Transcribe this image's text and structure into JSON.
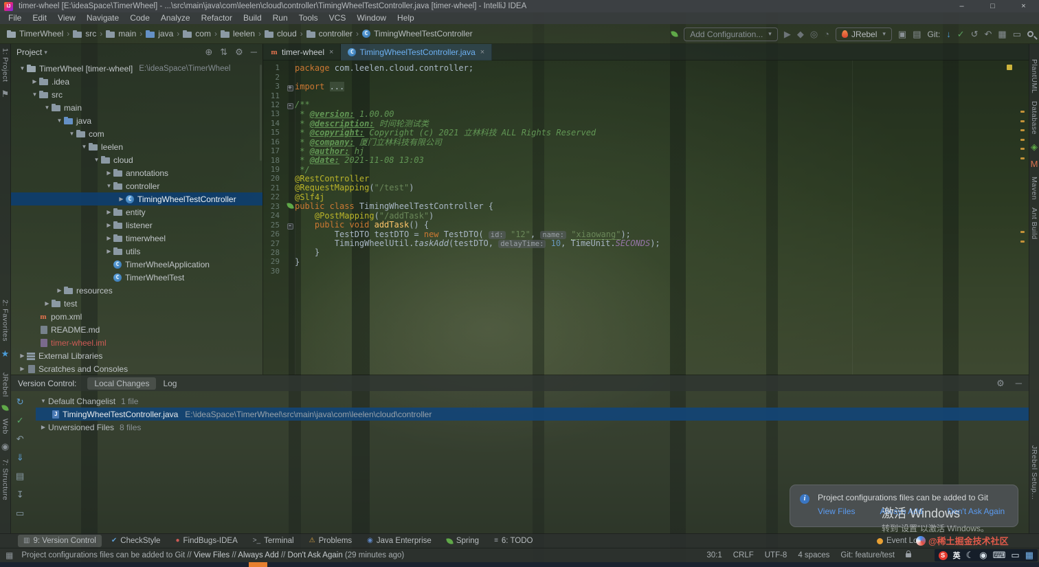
{
  "titlebar": {
    "title": "timer-wheel [E:\\ideaSpace\\TimerWheel] - ...\\src\\main\\java\\com\\leelen\\cloud\\controller\\TimingWheelTestController.java [timer-wheel] - IntelliJ IDEA",
    "controls": {
      "minimize": "–",
      "maximize": "□",
      "close": "×"
    }
  },
  "menubar": {
    "items": [
      "File",
      "Edit",
      "View",
      "Navigate",
      "Code",
      "Analyze",
      "Refactor",
      "Build",
      "Run",
      "Tools",
      "VCS",
      "Window",
      "Help"
    ]
  },
  "toolbar": {
    "breadcrumbs": [
      {
        "label": "TimerWheel",
        "icon": "project"
      },
      {
        "label": "src",
        "icon": "folder"
      },
      {
        "label": "main",
        "icon": "folder"
      },
      {
        "label": "java",
        "icon": "folder-src"
      },
      {
        "label": "com",
        "icon": "folder-pkg"
      },
      {
        "label": "leelen",
        "icon": "folder-pkg"
      },
      {
        "label": "cloud",
        "icon": "folder-pkg"
      },
      {
        "label": "controller",
        "icon": "folder-pkg"
      },
      {
        "label": "TimingWheelTestController",
        "icon": "class"
      }
    ],
    "run_config": "Add Configuration...",
    "jrebel_label": "JRebel",
    "git_label": "Git:",
    "icons_a": [
      "run-icon",
      "debug-icon",
      "coverage-icon",
      "profiler-icon"
    ],
    "icons_b": [
      "rebel-run-icon",
      "layout-icon"
    ],
    "git_icons": [
      "git-update-icon",
      "git-commit-icon",
      "git-history-icon",
      "git-rollback-icon"
    ],
    "icons_c": [
      "diagram-icon",
      "restore-layout-icon"
    ]
  },
  "stripes": {
    "left_top": [
      {
        "label": "1: Project"
      },
      {
        "icon": "bookmark-icon"
      }
    ],
    "left_mid": [
      {
        "label": "2: Favorites"
      },
      {
        "icon": "favorites-star-icon"
      }
    ],
    "left_bottom": [
      {
        "label": "JRebel"
      },
      {
        "icon": "jrebel-leaf-icon"
      },
      {
        "label": "Web"
      },
      {
        "icon": "eye-icon"
      },
      {
        "label": "7: Structure"
      }
    ],
    "right_top": [
      {
        "label": "PlantUML"
      },
      {
        "label": "Database"
      },
      {
        "icon": "plugin-icon"
      },
      {
        "label": "Maven",
        "icon": "maven-stripe-icon"
      },
      {
        "label": "Ant Build"
      }
    ],
    "right_bottom": [
      {
        "label": "JRebel Setup..."
      }
    ]
  },
  "project": {
    "header": "Project",
    "header_icons": [
      "locate-icon",
      "collapse-icon",
      "settings-icon",
      "hide-icon"
    ],
    "tree": [
      {
        "depth": 0,
        "arrow": "v",
        "icon": "project",
        "label": "TimerWheel [timer-wheel]",
        "extra": "E:\\ideaSpace\\TimerWheel"
      },
      {
        "depth": 1,
        "arrow": ">",
        "icon": "folder",
        "label": ".idea"
      },
      {
        "depth": 1,
        "arrow": "v",
        "icon": "folder",
        "label": "src"
      },
      {
        "depth": 2,
        "arrow": "v",
        "icon": "folder",
        "label": "main"
      },
      {
        "depth": 3,
        "arrow": "v",
        "icon": "folder-src",
        "label": "java"
      },
      {
        "depth": 4,
        "arrow": "v",
        "icon": "folder-pkg",
        "label": "com"
      },
      {
        "depth": 5,
        "arrow": "v",
        "icon": "folder-pkg",
        "label": "leelen"
      },
      {
        "depth": 6,
        "arrow": "v",
        "icon": "folder-pkg",
        "label": "cloud"
      },
      {
        "depth": 7,
        "arrow": ">",
        "icon": "folder-pkg",
        "label": "annotations"
      },
      {
        "depth": 7,
        "arrow": "v",
        "icon": "folder-pkg",
        "label": "controller"
      },
      {
        "depth": 8,
        "arrow": ">",
        "icon": "class",
        "label": "TimingWheelTestController",
        "selected": true
      },
      {
        "depth": 7,
        "arrow": ">",
        "icon": "folder-pkg",
        "label": "entity"
      },
      {
        "depth": 7,
        "arrow": ">",
        "icon": "folder-pkg",
        "label": "listener"
      },
      {
        "depth": 7,
        "arrow": ">",
        "icon": "folder-pkg",
        "label": "timerwheel"
      },
      {
        "depth": 7,
        "arrow": ">",
        "icon": "folder-pkg",
        "label": "utils"
      },
      {
        "depth": 7,
        "arrow": "",
        "icon": "class",
        "label": "TimerWheelApplication"
      },
      {
        "depth": 7,
        "arrow": "",
        "icon": "class",
        "label": "TimerWheelTest"
      },
      {
        "depth": 3,
        "arrow": ">",
        "icon": "folder",
        "label": "resources"
      },
      {
        "depth": 2,
        "arrow": ">",
        "icon": "folder",
        "label": "test"
      },
      {
        "depth": 1,
        "arrow": "",
        "icon": "maven",
        "label": "pom.xml"
      },
      {
        "depth": 1,
        "arrow": "",
        "icon": "md",
        "label": "README.md"
      },
      {
        "depth": 1,
        "arrow": "",
        "icon": "iml",
        "label": "timer-wheel.iml",
        "red": true
      },
      {
        "depth": 0,
        "arrow": ">",
        "icon": "lib",
        "label": "External Libraries"
      },
      {
        "depth": 0,
        "arrow": ">",
        "icon": "scratch",
        "label": "Scratches and Consoles"
      }
    ]
  },
  "editor": {
    "tabs": [
      {
        "label": "timer-wheel",
        "icon": "maven",
        "close": "×",
        "active": false
      },
      {
        "label": "TimingWheelTestController.java",
        "icon": "class",
        "close": "×",
        "active": true
      }
    ],
    "warning_lines": [
      "13",
      "14",
      "15",
      "16",
      "17",
      "18",
      "26",
      "27"
    ],
    "code_lines": [
      {
        "n": "1",
        "s": [
          [
            "package ",
            "kw"
          ],
          [
            "com.leelen.cloud.controller;",
            "pl"
          ]
        ]
      },
      {
        "n": "2",
        "s": []
      },
      {
        "n": "3",
        "f": "+",
        "s": [
          [
            "import ",
            "kw"
          ],
          [
            "...",
            "foldtxt"
          ]
        ]
      },
      {
        "n": "11",
        "s": []
      },
      {
        "n": "12",
        "f": "-",
        "s": [
          [
            "/**",
            "doc"
          ]
        ]
      },
      {
        "n": "13",
        "s": [
          [
            " * ",
            "doc"
          ],
          [
            "@version:",
            "doctag"
          ],
          [
            " 1.00.00",
            "doc"
          ]
        ]
      },
      {
        "n": "14",
        "s": [
          [
            " * ",
            "doc"
          ],
          [
            "@description:",
            "doctag"
          ],
          [
            " 时间轮测试类",
            "doc"
          ]
        ]
      },
      {
        "n": "15",
        "s": [
          [
            " * ",
            "doc"
          ],
          [
            "@copyright:",
            "doctag"
          ],
          [
            " Copyright (c) 2021 立林科技 ALL Rights Reserved",
            "doc"
          ]
        ]
      },
      {
        "n": "16",
        "s": [
          [
            " * ",
            "doc"
          ],
          [
            "@company:",
            "doctag"
          ],
          [
            " 厦门立林科技有限公司",
            "doc"
          ]
        ]
      },
      {
        "n": "17",
        "s": [
          [
            " * ",
            "doc"
          ],
          [
            "@author:",
            "doctag"
          ],
          [
            " hj",
            "doc"
          ]
        ]
      },
      {
        "n": "18",
        "s": [
          [
            " * ",
            "doc"
          ],
          [
            "@date:",
            "doctag"
          ],
          [
            " 2021-11-08 13:03",
            "doc"
          ]
        ]
      },
      {
        "n": "19",
        "s": [
          [
            " */",
            "doc"
          ]
        ]
      },
      {
        "n": "20",
        "s": [
          [
            "@RestController",
            "ann"
          ]
        ]
      },
      {
        "n": "21",
        "s": [
          [
            "@RequestMapping",
            "ann"
          ],
          [
            "(",
            "pl"
          ],
          [
            "\"/test\"",
            "str"
          ],
          [
            ")",
            "pl"
          ]
        ]
      },
      {
        "n": "22",
        "s": [
          [
            "@Slf4j",
            "ann"
          ]
        ]
      },
      {
        "n": "23",
        "g": "spring",
        "s": [
          [
            "public class ",
            "kw"
          ],
          [
            "TimingWheelTestController {",
            "pl"
          ]
        ]
      },
      {
        "n": "24",
        "s": [
          [
            "    ",
            "pl"
          ],
          [
            "@PostMapping",
            "ann"
          ],
          [
            "(",
            "pl"
          ],
          [
            "\"/addTask\"",
            "str"
          ],
          [
            ")",
            "pl"
          ]
        ]
      },
      {
        "n": "25",
        "f": "-",
        "s": [
          [
            "    ",
            "pl"
          ],
          [
            "public void ",
            "kw"
          ],
          [
            "addTask",
            "mtd"
          ],
          [
            "() {",
            "pl"
          ]
        ]
      },
      {
        "n": "26",
        "s": [
          [
            "        TestDTO testDTO = ",
            "pl"
          ],
          [
            "new",
            "kw"
          ],
          [
            " TestDTO( ",
            "pl"
          ],
          [
            "id:",
            "hint"
          ],
          [
            " ",
            "pl"
          ],
          [
            "\"12\"",
            "str"
          ],
          [
            ", ",
            "pl"
          ],
          [
            "name:",
            "hint"
          ],
          [
            " ",
            "pl"
          ],
          [
            "\"xiaowang\"",
            "strw"
          ],
          [
            ");",
            "pl"
          ]
        ]
      },
      {
        "n": "27",
        "s": [
          [
            "        TimingWheelUtil.",
            "pl"
          ],
          [
            "taskAdd",
            "smtd"
          ],
          [
            "(testDTO, ",
            "pl"
          ],
          [
            "delayTime:",
            "hint"
          ],
          [
            " ",
            "pl"
          ],
          [
            "10",
            "num"
          ],
          [
            ", TimeUnit.",
            "pl"
          ],
          [
            "SECONDS",
            "const"
          ],
          [
            ");",
            "pl"
          ]
        ]
      },
      {
        "n": "28",
        "s": [
          [
            "    }",
            "pl"
          ]
        ]
      },
      {
        "n": "29",
        "s": [
          [
            "}",
            "pl"
          ]
        ]
      },
      {
        "n": "30",
        "s": []
      }
    ]
  },
  "vcs": {
    "title": "Version Control:",
    "tabs": [
      {
        "label": "Local Changes",
        "active": true
      },
      {
        "label": "Log",
        "active": false
      }
    ],
    "header_icons": [
      "vcs-settings-icon",
      "vcs-hide-icon"
    ],
    "toolbar_icons": [
      "refresh-icon",
      "commit-icon",
      "rollback-icon",
      "shelve-icon",
      "patch-icon",
      "unshelve-icon",
      "history-icon"
    ],
    "rows": [
      {
        "type": "group",
        "arrow": "v",
        "label": "Default Changelist",
        "count": "1 file"
      },
      {
        "type": "file",
        "icon": "java-file",
        "label": "TimingWheelTestController.java",
        "path": "E:\\ideaSpace\\TimerWheel\\src\\main\\java\\com\\leelen\\cloud\\controller",
        "selected": true
      },
      {
        "type": "group",
        "arrow": ">",
        "label": "Unversioned Files",
        "count": "8 files"
      }
    ]
  },
  "toolwindow_bar": {
    "items": [
      {
        "icon": "vcs",
        "label": "9: Version Control",
        "active": true
      },
      {
        "icon": "checkstyle",
        "label": "CheckStyle"
      },
      {
        "icon": "findbugs",
        "label": "FindBugs-IDEA"
      },
      {
        "icon": "terminal",
        "label": "Terminal"
      },
      {
        "icon": "problems",
        "label": "Problems"
      },
      {
        "icon": "javaee",
        "label": "Java Enterprise"
      },
      {
        "icon": "spring",
        "label": "Spring"
      },
      {
        "icon": "todo",
        "label": "6: TODO"
      }
    ]
  },
  "statusbar": {
    "message_parts": [
      {
        "t": "Project configurations files can be added to Git // "
      },
      {
        "t": "View Files",
        "link": true
      },
      {
        "t": " // "
      },
      {
        "t": "Always Add",
        "link": true
      },
      {
        "t": " // "
      },
      {
        "t": "Don't Ask Again",
        "link": true
      },
      {
        "t": " (29 minutes ago)"
      }
    ],
    "position": "30:1",
    "line_sep": "CRLF",
    "encoding": "UTF-8",
    "indent": "4 spaces",
    "git_branch": "Git: feature/test"
  },
  "notification": {
    "text": "Project configurations files can be added to Git",
    "links": [
      "View Files",
      "Always Add",
      "Don't Ask Again"
    ]
  },
  "watermarks": {
    "activate_title": "激活 Windows",
    "activate_sub": "转到“设置”以激活 Windows。",
    "event_log": "Event Log",
    "juejin": "@稀土掘金技术社区"
  },
  "tray": {
    "ime": "英",
    "icons": [
      "sogou-icon",
      "moon-icon",
      "mic-icon",
      "keyboard-icon",
      "screen-icon",
      "grid-icon"
    ]
  }
}
